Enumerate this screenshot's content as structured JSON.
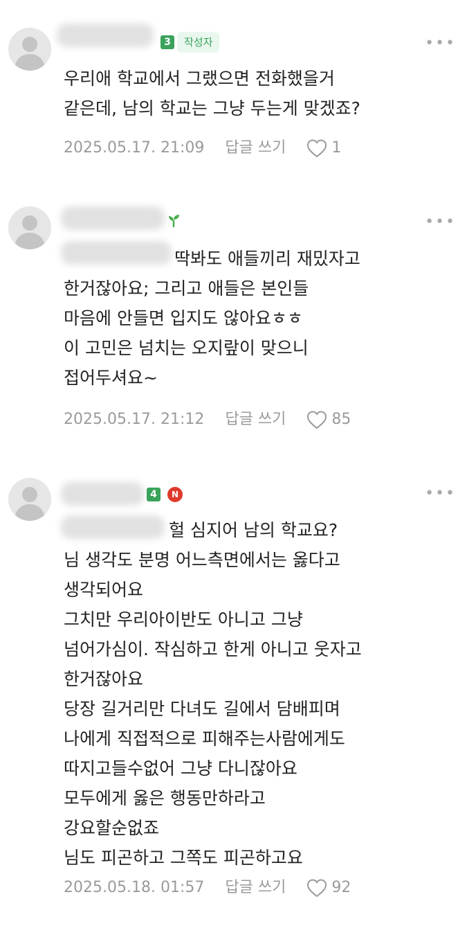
{
  "comments": [
    {
      "level": "3",
      "level_color": "#39a35b",
      "author_badge": "작성자",
      "lines": [
        "우리애 학교에서 그랬으면 전화했을거",
        "같은데, 남의 학교는 그냥 두는게 맞겠죠?"
      ],
      "date": "2025.05.17. 21:09",
      "reply_label": "답글 쓰기",
      "likes": "1"
    },
    {
      "sprout_icon": "sprout-icon",
      "lines": [
        "딱봐도 애들끼리 재밌자고",
        "한거잖아요; 그리고 애들은 본인들",
        "마음에 안들면 입지도 않아요ㅎㅎ",
        "이 고민은 넘치는 오지랖이 맞으니",
        "접어두셔요~"
      ],
      "date": "2025.05.17. 21:12",
      "reply_label": "답글 쓰기",
      "likes": "85"
    },
    {
      "level": "4",
      "level_color": "#39a35b",
      "naver_badge": "N",
      "lines": [
        "헐 심지어 남의 학교요?",
        "님 생각도 분명 어느측면에서는 옳다고",
        "생각되어요",
        "그치만 우리아이반도 아니고 그냥",
        "넘어가심이. 작심하고 한게 아니고 웃자고",
        "한거잖아요",
        "당장 길거리만 다녀도 길에서 담배피며",
        "나에게 직접적으로 피해주는사람에게도",
        "따지고들수없어 그냥 다니잖아요",
        "모두에게 옳은 행동만하라고",
        "강요할순없죠",
        "님도 피곤하고 그쪽도 피곤하고요"
      ],
      "date": "2025.05.18. 01:57",
      "reply_label": "답글 쓰기",
      "likes": "92"
    }
  ]
}
